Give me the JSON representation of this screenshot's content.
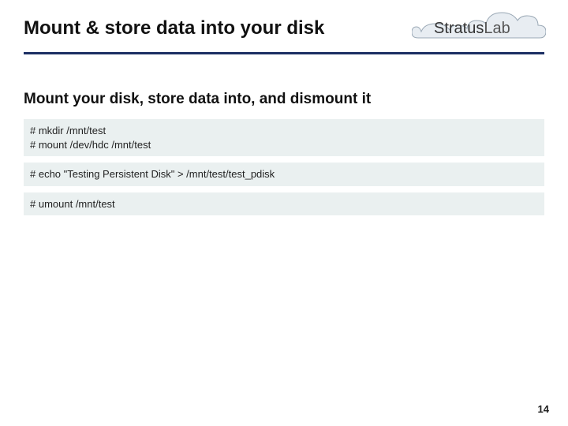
{
  "header": {
    "title": "Mount & store data into your disk"
  },
  "logo": {
    "text_main": "Stratus",
    "text_sub": "Lab"
  },
  "section": {
    "subtitle": "Mount your disk, store data into, and dismount it"
  },
  "code": {
    "block1": "# mkdir /mnt/test\n# mount /dev/hdc /mnt/test",
    "block2": "# echo \"Testing Persistent Disk\" > /mnt/test/test_pdisk",
    "block3": "# umount /mnt/test"
  },
  "footer": {
    "page_number": "14"
  }
}
